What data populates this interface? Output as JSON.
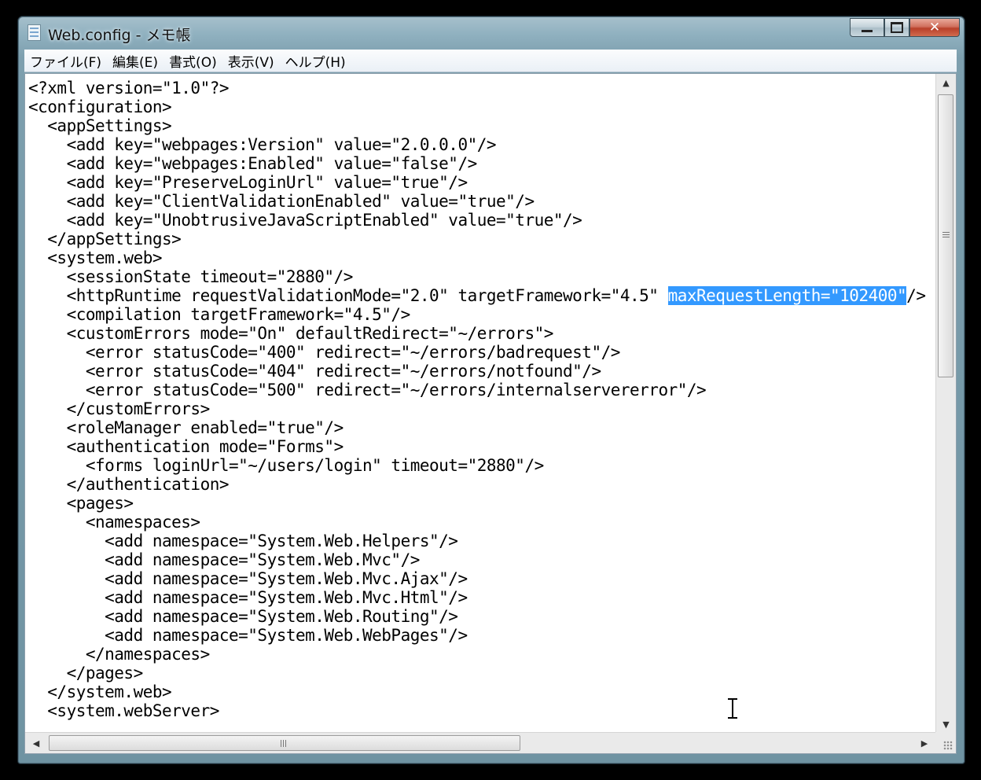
{
  "window": {
    "title": "Web.config - メモ帳",
    "controls": {
      "minimize_icon": "minimize-icon",
      "maximize_icon": "maximize-icon",
      "close_label": "✕"
    }
  },
  "menu": [
    {
      "label": "ファイル(F)"
    },
    {
      "label": "編集(E)"
    },
    {
      "label": "書式(O)"
    },
    {
      "label": "表示(V)"
    },
    {
      "label": "ヘルプ(H)"
    }
  ],
  "editor": {
    "lines": [
      "<?xml version=\"1.0\"?>",
      "<configuration>",
      "  <appSettings>",
      "    <add key=\"webpages:Version\" value=\"2.0.0.0\"/>",
      "    <add key=\"webpages:Enabled\" value=\"false\"/>",
      "    <add key=\"PreserveLoginUrl\" value=\"true\"/>",
      "    <add key=\"ClientValidationEnabled\" value=\"true\"/>",
      "    <add key=\"UnobtrusiveJavaScriptEnabled\" value=\"true\"/>",
      "  </appSettings>",
      "  <system.web>",
      "    <sessionState timeout=\"2880\"/>",
      "    <httpRuntime requestValidationMode=\"2.0\" targetFramework=\"4.5\" ",
      "    <compilation targetFramework=\"4.5\"/>",
      "    <customErrors mode=\"On\" defaultRedirect=\"~/errors\">",
      "      <error statusCode=\"400\" redirect=\"~/errors/badrequest\"/>",
      "      <error statusCode=\"404\" redirect=\"~/errors/notfound\"/>",
      "      <error statusCode=\"500\" redirect=\"~/errors/internalservererror\"/>",
      "    </customErrors>",
      "    <roleManager enabled=\"true\"/>",
      "    <authentication mode=\"Forms\">",
      "      <forms loginUrl=\"~/users/login\" timeout=\"2880\"/>",
      "    </authentication>",
      "    <pages>",
      "      <namespaces>",
      "        <add namespace=\"System.Web.Helpers\"/>",
      "        <add namespace=\"System.Web.Mvc\"/>",
      "        <add namespace=\"System.Web.Mvc.Ajax\"/>",
      "        <add namespace=\"System.Web.Mvc.Html\"/>",
      "        <add namespace=\"System.Web.Routing\"/>",
      "        <add namespace=\"System.Web.WebPages\"/>",
      "      </namespaces>",
      "    </pages>",
      "  </system.web>",
      "  <system.webServer>"
    ],
    "selection": {
      "line": 11,
      "selected_text": "maxRequestLength=\"102400\"",
      "after_text": "/>"
    }
  },
  "scrollbars": {
    "vertical_position": 0.0,
    "horizontal_position": 0.0,
    "up_arrow": "▲",
    "down_arrow": "▼",
    "left_arrow": "◀",
    "right_arrow": "▶"
  },
  "colors": {
    "selection": "#3399ff",
    "text": "#000000",
    "background": "#ffffff"
  }
}
